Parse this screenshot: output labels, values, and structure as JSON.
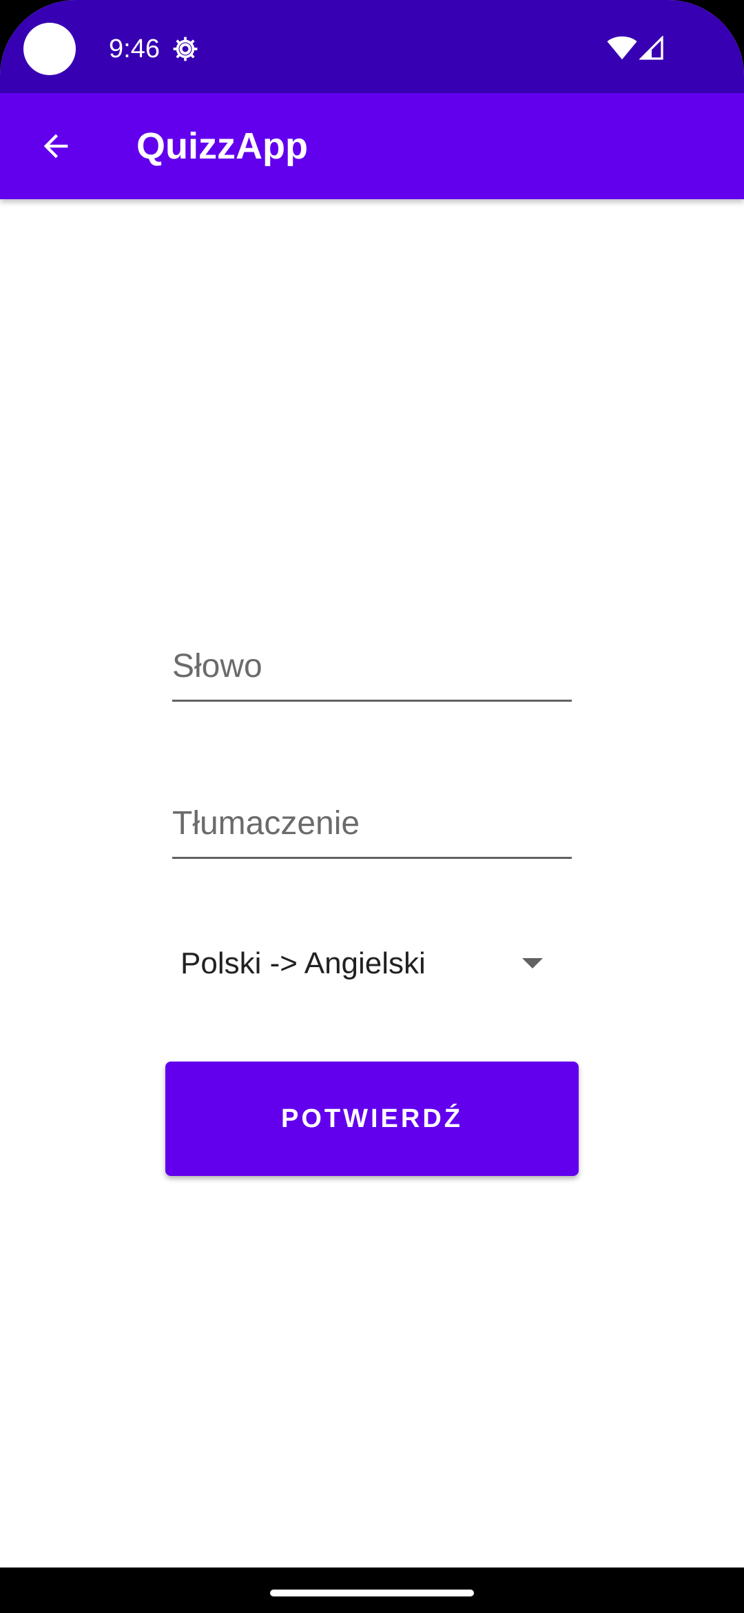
{
  "status_bar": {
    "time": "9:46",
    "icons": [
      "settings-icon",
      "wifi-icon",
      "signal-icon"
    ]
  },
  "app_bar": {
    "title": "QuizzApp",
    "back_icon": "arrow-back-icon"
  },
  "form": {
    "word_placeholder": "Słowo",
    "translation_placeholder": "Tłumaczenie",
    "direction_selected": "Polski -> Angielski",
    "confirm_label": "POTWIERDŹ"
  },
  "colors": {
    "status_bar": "#3700b3",
    "primary": "#6200ee",
    "background": "#ffffff"
  }
}
